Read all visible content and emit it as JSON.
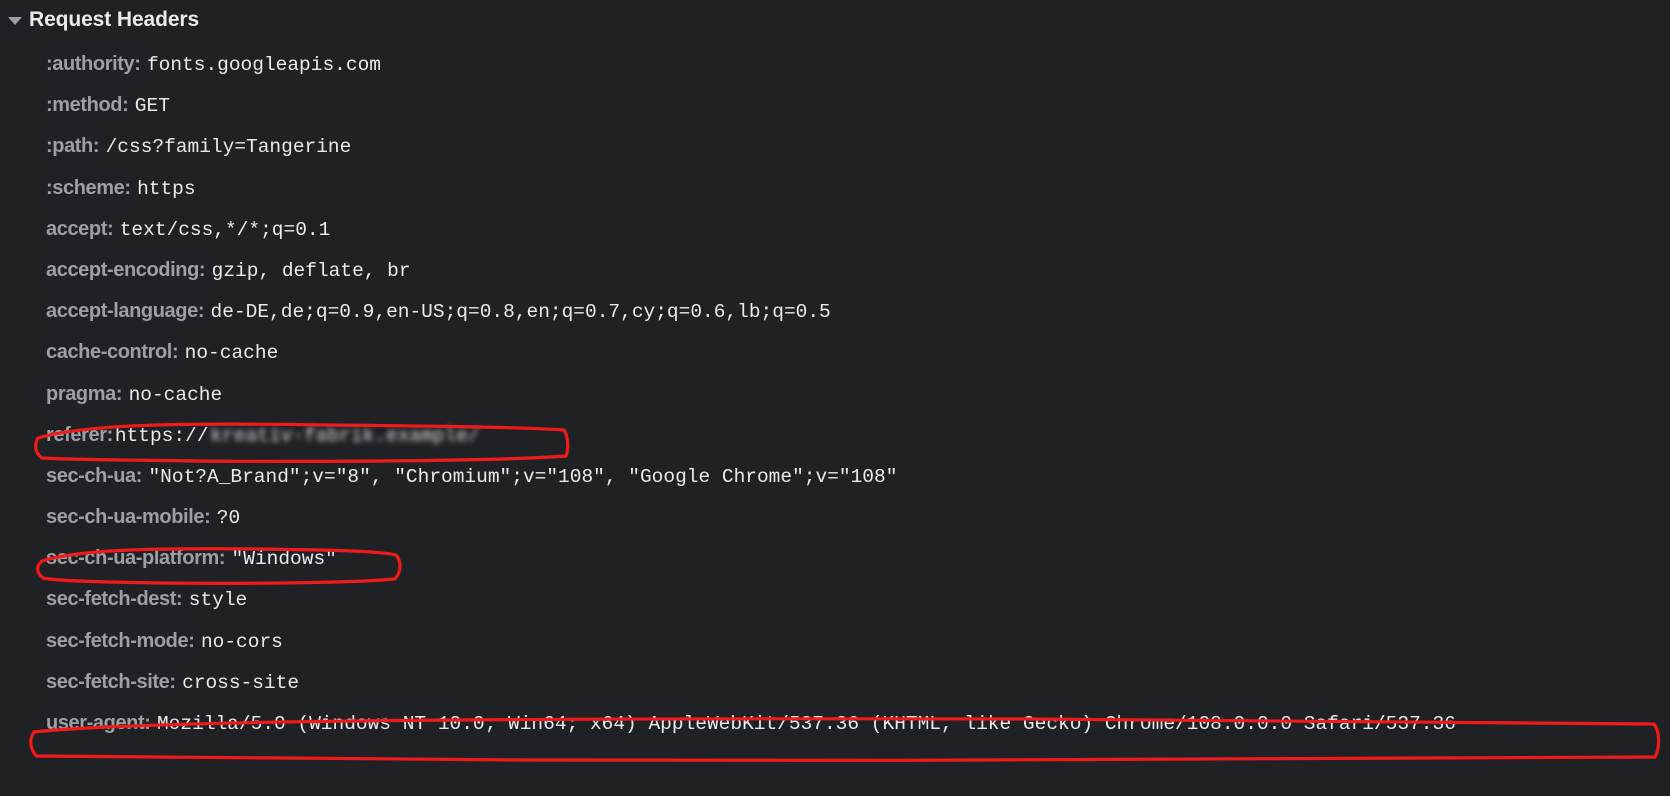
{
  "panel": {
    "background_color": "#202124",
    "name_color": "#9aa0a6",
    "value_color": "#e8eaed",
    "annotation_color": "#f01a1a"
  },
  "section": {
    "title": "Request Headers",
    "disclosure_icon": "triangle-down-icon",
    "expanded": true
  },
  "headers": [
    {
      "name": ":authority:",
      "value": "fonts.googleapis.com",
      "annotated": false,
      "redacted": false
    },
    {
      "name": ":method:",
      "value": "GET",
      "annotated": false,
      "redacted": false
    },
    {
      "name": ":path:",
      "value": "/css?family=Tangerine",
      "annotated": false,
      "redacted": false
    },
    {
      "name": ":scheme:",
      "value": "https",
      "annotated": false,
      "redacted": false
    },
    {
      "name": "accept:",
      "value": "text/css,*/*;q=0.1",
      "annotated": false,
      "redacted": false
    },
    {
      "name": "accept-encoding:",
      "value": "gzip, deflate, br",
      "annotated": false,
      "redacted": false
    },
    {
      "name": "accept-language:",
      "value": "de-DE,de;q=0.9,en-US;q=0.8,en;q=0.7,cy;q=0.6,lb;q=0.5",
      "annotated": false,
      "redacted": false
    },
    {
      "name": "cache-control:",
      "value": "no-cache",
      "annotated": false,
      "redacted": false
    },
    {
      "name": "pragma:",
      "value": "no-cache",
      "annotated": false,
      "redacted": false
    },
    {
      "name": "referer:",
      "value": "https://",
      "redacted_value": "kreativ-fabrik.example/",
      "annotated": true,
      "redacted": true
    },
    {
      "name": "sec-ch-ua:",
      "value": "\"Not?A_Brand\";v=\"8\", \"Chromium\";v=\"108\", \"Google Chrome\";v=\"108\"",
      "annotated": false,
      "redacted": false
    },
    {
      "name": "sec-ch-ua-mobile:",
      "value": "?0",
      "annotated": false,
      "redacted": false
    },
    {
      "name": "sec-ch-ua-platform:",
      "value": "\"Windows\"",
      "annotated": true,
      "redacted": false
    },
    {
      "name": "sec-fetch-dest:",
      "value": "style",
      "annotated": false,
      "redacted": false
    },
    {
      "name": "sec-fetch-mode:",
      "value": "no-cors",
      "annotated": false,
      "redacted": false
    },
    {
      "name": "sec-fetch-site:",
      "value": "cross-site",
      "annotated": false,
      "redacted": false
    },
    {
      "name": "user-agent:",
      "value": "Mozilla/5.0 (Windows NT 10.0; Win64; x64) AppleWebKit/537.36 (KHTML, like Gecko) Chrome/108.0.0.0 Safari/537.36",
      "annotated": true,
      "redacted": false
    }
  ],
  "annotations": [
    {
      "id": "referer-highlight",
      "target": "referer"
    },
    {
      "id": "sec-ch-ua-platform-highlight",
      "target": "sec-ch-ua-platform"
    },
    {
      "id": "user-agent-highlight",
      "target": "user-agent"
    }
  ]
}
